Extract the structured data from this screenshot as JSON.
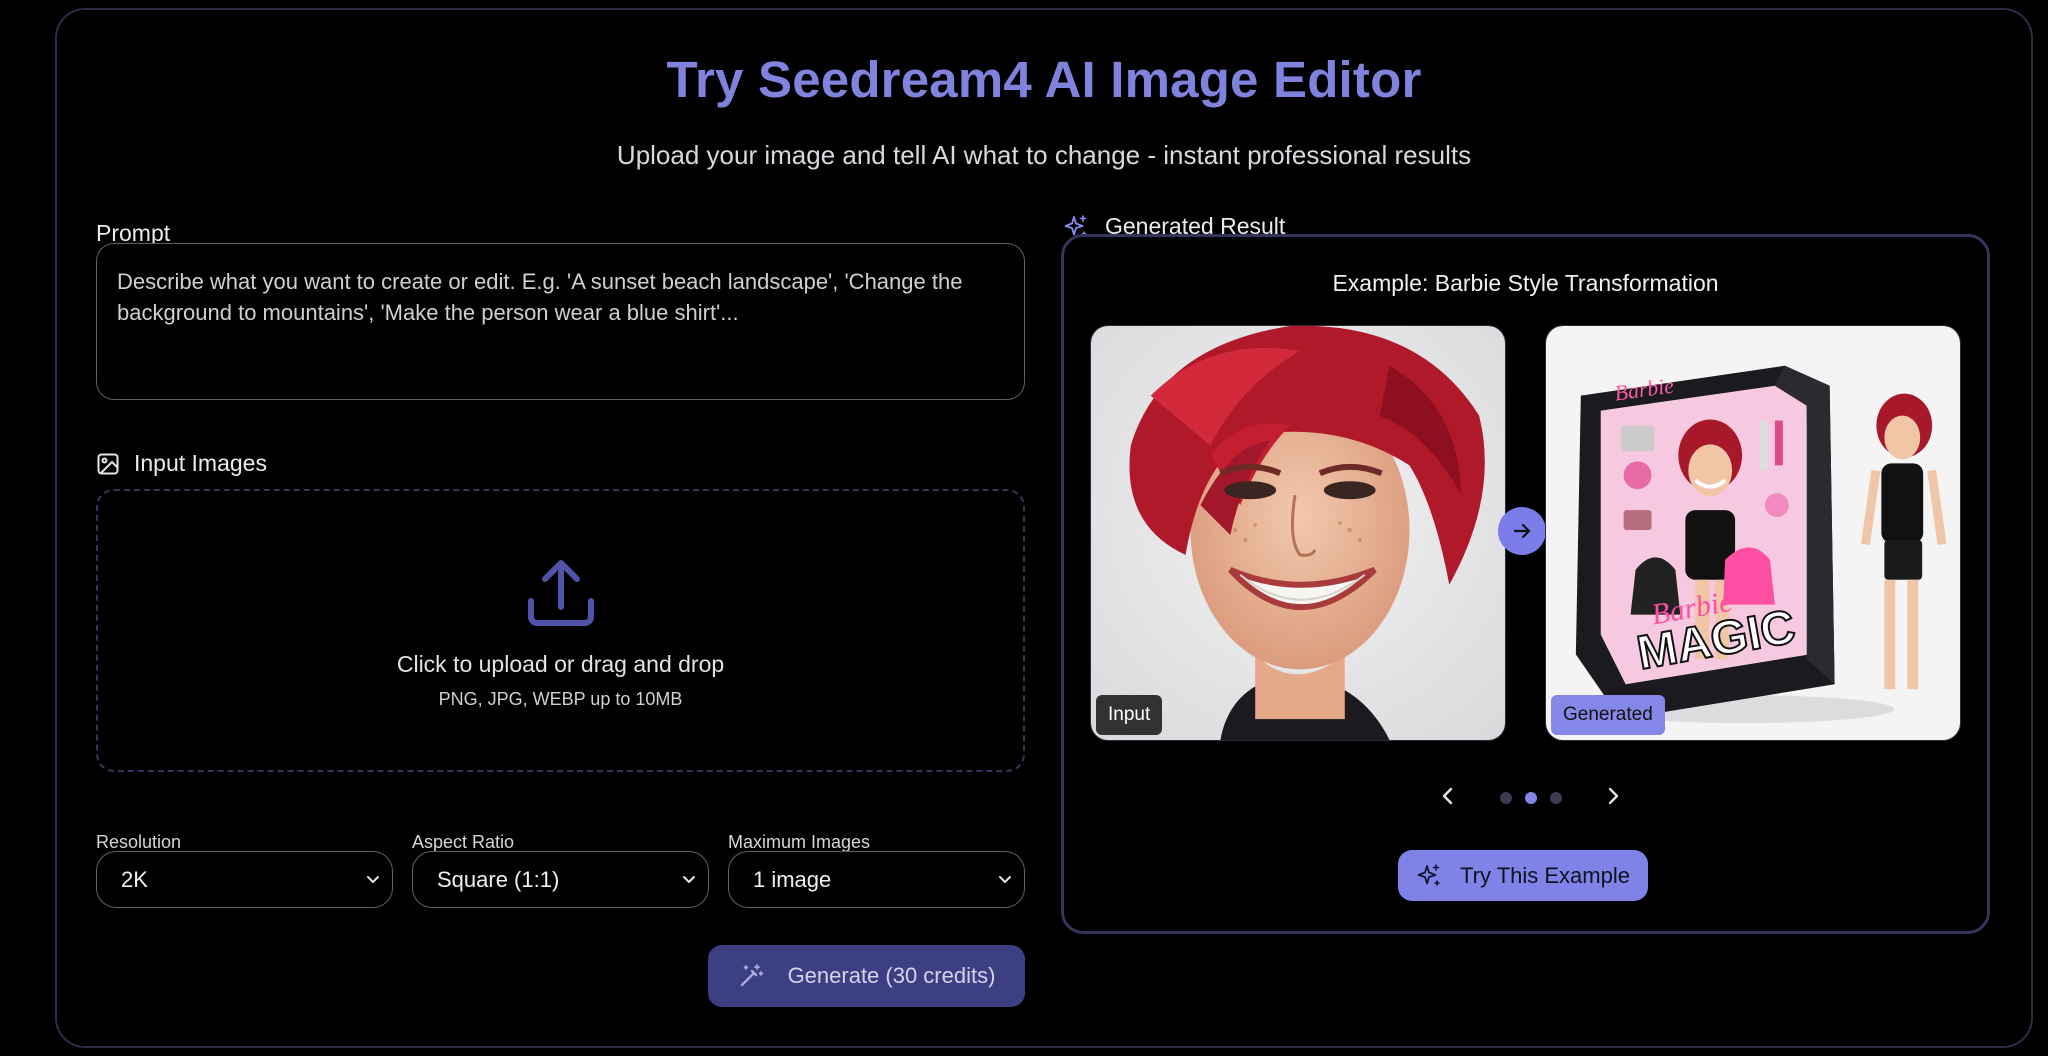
{
  "header": {
    "title": "Try Seedream4 AI Image Editor",
    "subtitle": "Upload your image and tell AI what to change - instant professional results"
  },
  "prompt": {
    "label": "Prompt",
    "placeholder": "Describe what you want to create or edit. E.g. 'A sunset beach landscape', 'Change the background to mountains', 'Make the person wear a blue shirt'..."
  },
  "input_images": {
    "label": "Input Images",
    "icon": "image-icon",
    "upload_text": "Click to upload or drag and drop",
    "upload_hint": "PNG, JPG, WEBP up to 10MB"
  },
  "settings": {
    "resolution": {
      "label": "Resolution",
      "value": "2K"
    },
    "aspect_ratio": {
      "label": "Aspect Ratio",
      "value": "Square (1:1)"
    },
    "max_images": {
      "label": "Maximum Images",
      "value": "1 image"
    }
  },
  "generate_button": {
    "label": "Generate (30 credits)",
    "icon": "magic-wand-icon"
  },
  "result": {
    "heading": "Generated Result",
    "icon": "sparkles-icon",
    "example_title": "Example: Barbie Style Transformation",
    "input_badge": "Input",
    "generated_badge": "Generated",
    "box_brand": "Barbie",
    "box_title": "MAGIC",
    "carousel": {
      "count": 3,
      "active_index": 1
    },
    "try_button": "Try This Example"
  },
  "colors": {
    "accent": "#7f83dd",
    "accent_button": "#7f83e8",
    "generate_button_bg": "#3d3f83",
    "panel_border": "#33365a"
  }
}
